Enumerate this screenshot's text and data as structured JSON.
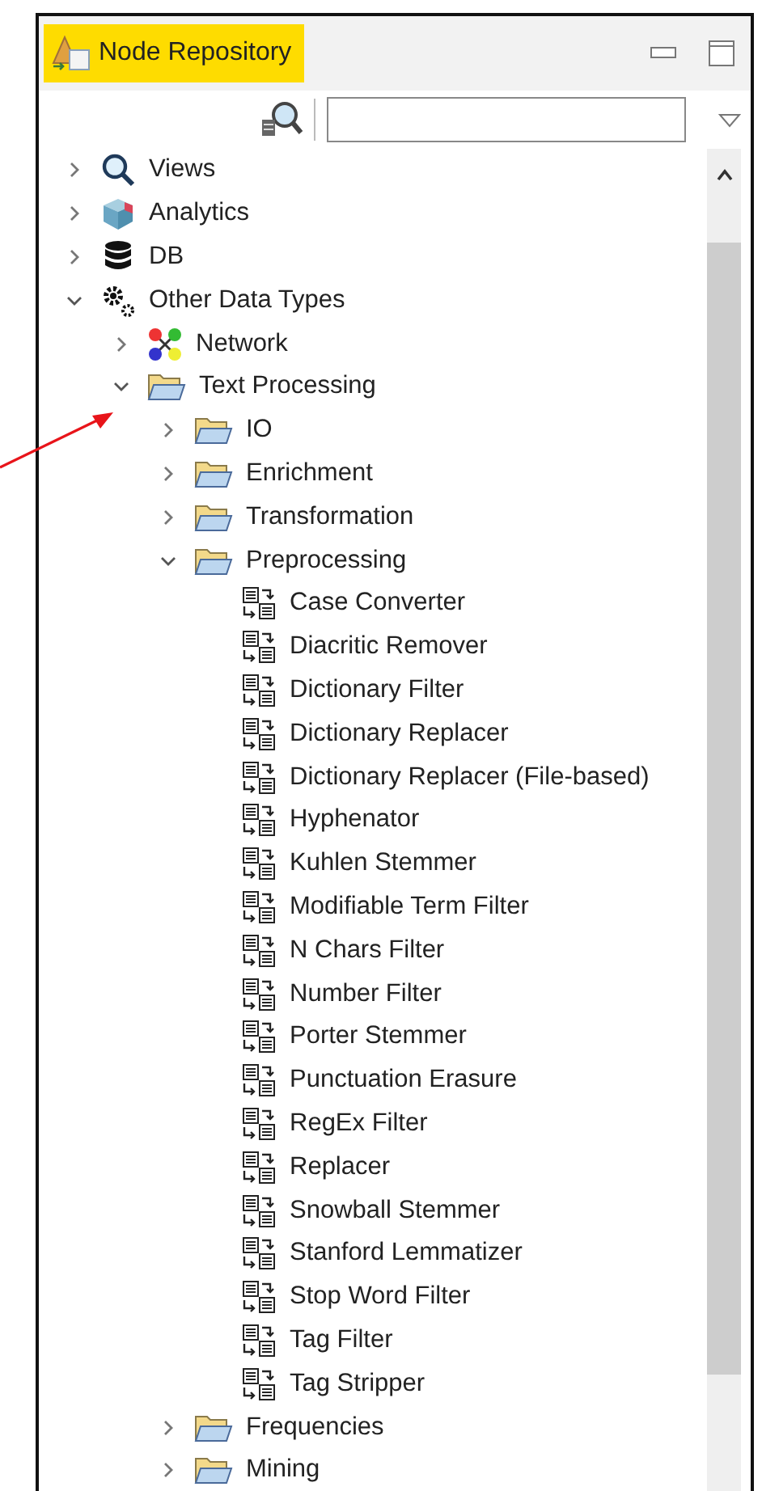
{
  "panel": {
    "title": "Node Repository"
  },
  "tree": [
    {
      "label": "Views",
      "kind": "magnifier",
      "expanded": false
    },
    {
      "label": "Analytics",
      "kind": "cube",
      "expanded": false
    },
    {
      "label": "DB",
      "kind": "database",
      "expanded": false
    },
    {
      "label": "Other Data Types",
      "kind": "gears",
      "expanded": true,
      "children": [
        {
          "label": "Network",
          "kind": "network",
          "expanded": false
        },
        {
          "label": "Text Processing",
          "kind": "folder",
          "expanded": true,
          "children": [
            {
              "label": "IO",
              "kind": "folder",
              "expanded": false
            },
            {
              "label": "Enrichment",
              "kind": "folder",
              "expanded": false
            },
            {
              "label": "Transformation",
              "kind": "folder",
              "expanded": false
            },
            {
              "label": "Preprocessing",
              "kind": "folder",
              "expanded": true,
              "children": [
                {
                  "label": "Case Converter",
                  "kind": "node"
                },
                {
                  "label": "Diacritic Remover",
                  "kind": "node"
                },
                {
                  "label": "Dictionary Filter",
                  "kind": "node"
                },
                {
                  "label": "Dictionary Replacer",
                  "kind": "node"
                },
                {
                  "label": "Dictionary Replacer (File-based)",
                  "kind": "node"
                },
                {
                  "label": "Hyphenator",
                  "kind": "node"
                },
                {
                  "label": "Kuhlen Stemmer",
                  "kind": "node"
                },
                {
                  "label": "Modifiable Term Filter",
                  "kind": "node"
                },
                {
                  "label": "N Chars Filter",
                  "kind": "node"
                },
                {
                  "label": "Number Filter",
                  "kind": "node"
                },
                {
                  "label": "Porter Stemmer",
                  "kind": "node"
                },
                {
                  "label": "Punctuation Erasure",
                  "kind": "node"
                },
                {
                  "label": "RegEx Filter",
                  "kind": "node"
                },
                {
                  "label": "Replacer",
                  "kind": "node"
                },
                {
                  "label": "Snowball Stemmer",
                  "kind": "node"
                },
                {
                  "label": "Stanford Lemmatizer",
                  "kind": "node"
                },
                {
                  "label": "Stop Word Filter",
                  "kind": "node"
                },
                {
                  "label": "Tag Filter",
                  "kind": "node"
                },
                {
                  "label": "Tag Stripper",
                  "kind": "node"
                }
              ]
            },
            {
              "label": "Frequencies",
              "kind": "folder",
              "expanded": false
            },
            {
              "label": "Mining",
              "kind": "folder",
              "expanded": false
            }
          ]
        }
      ]
    }
  ]
}
